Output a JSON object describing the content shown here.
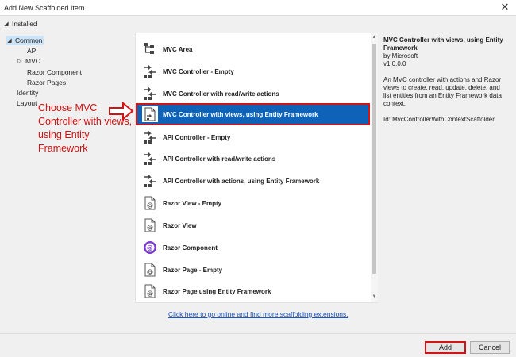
{
  "window": {
    "title": "Add New Scaffolded Item",
    "close_glyph": "✕"
  },
  "sidebar": {
    "installed_label": "Installed",
    "items": [
      {
        "label": "Common",
        "expander": "expanded",
        "selected": true
      },
      {
        "label": "API"
      },
      {
        "label": "MVC",
        "expander": "collapsed"
      },
      {
        "label": "Razor Component"
      },
      {
        "label": "Razor Pages"
      },
      {
        "label": "Identity"
      },
      {
        "label": "Layout"
      }
    ]
  },
  "annotation": {
    "callout_text": "Choose MVC Controller with views, using Entity Framework",
    "color": "#d41010"
  },
  "templates": {
    "items": [
      {
        "label": "MVC Area",
        "icon": "mvc-area-icon"
      },
      {
        "label": "MVC Controller - Empty",
        "icon": "controller-icon"
      },
      {
        "label": "MVC Controller with read/write actions",
        "icon": "controller-icon"
      },
      {
        "label": "MVC Controller with views, using Entity Framework",
        "icon": "controller-ef-icon",
        "selected": true
      },
      {
        "label": "API Controller - Empty",
        "icon": "controller-icon"
      },
      {
        "label": "API Controller with read/write actions",
        "icon": "controller-icon"
      },
      {
        "label": "API Controller with actions, using Entity Framework",
        "icon": "controller-icon"
      },
      {
        "label": "Razor View - Empty",
        "icon": "razor-view-icon"
      },
      {
        "label": "Razor View",
        "icon": "razor-view-icon"
      },
      {
        "label": "Razor Component",
        "icon": "blazor-icon"
      },
      {
        "label": "Razor Page - Empty",
        "icon": "razor-view-icon"
      },
      {
        "label": "Razor Page using Entity Framework",
        "icon": "razor-view-icon"
      }
    ]
  },
  "details": {
    "title": "MVC Controller with views, using Entity Framework",
    "author": "by Microsoft",
    "version": "v1.0.0.0",
    "description": "An MVC controller with actions and Razor views to create, read, update, delete, and list entities from an Entity Framework data context.",
    "id": "Id: MvcControllerWithContextScaffolder"
  },
  "online_link": "Click here to go online and find more scaffolding extensions.",
  "buttons": {
    "add": "Add",
    "cancel": "Cancel"
  },
  "colors": {
    "selection": "#0e63b8",
    "highlight": "#d11515",
    "link": "#1a55c7"
  }
}
